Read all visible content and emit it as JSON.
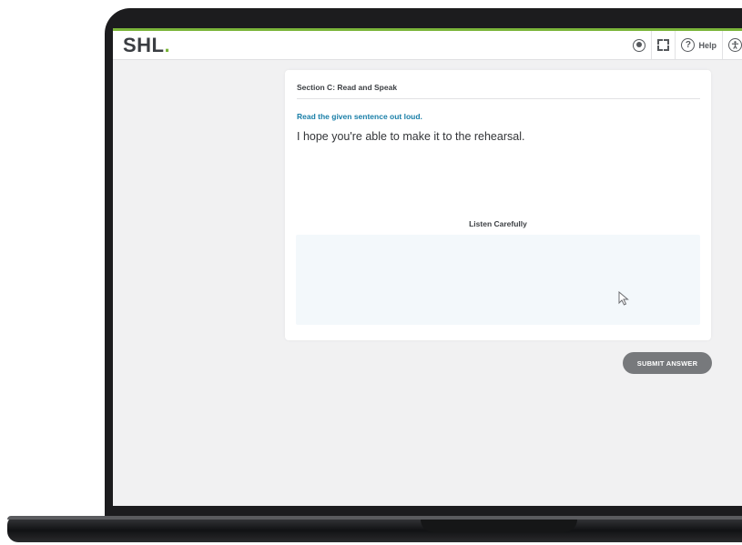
{
  "app": {
    "logo": "SHL",
    "logo_dot": "."
  },
  "toolbar": {
    "record_icon": "record-icon",
    "fullscreen_icon": "fullscreen-icon",
    "help_icon": "help-icon",
    "help_label": "Help",
    "help_glyph": "?",
    "accessibility_icon": "accessibility-icon"
  },
  "question": {
    "section_title": "Section C: Read and Speak",
    "instruction": "Read the given sentence out loud.",
    "sentence": "I hope you're able to make it to the rehearsal.",
    "listen_label": "Listen Carefully"
  },
  "actions": {
    "submit_label": "SUBMIT ANSWER"
  },
  "colors": {
    "brand_green": "#7bb53a",
    "instruction_blue": "#1a7fa8",
    "submit_gray": "#77797c",
    "audio_panel": "#f3f8fb"
  }
}
